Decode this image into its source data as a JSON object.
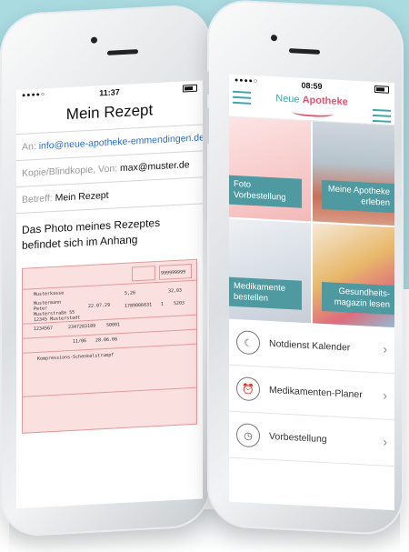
{
  "left_phone": {
    "status_time": "11:37",
    "signal": "●●●●○",
    "mail_title": "Mein Rezept",
    "to_label": "An:",
    "to_value": "info@neue-apotheke-emmendingen.de",
    "cc_label": "Kopie/Blindkopie, Von:",
    "cc_value": "max@muster.de",
    "subject_label": "Betreff:",
    "subject_value": "Mein Rezept",
    "body": "Das Photo meines Rezeptes befindet sich im Anhang",
    "rx": {
      "insurer": "Musterkasse",
      "name_1": "Mustermann",
      "name_2": "Peter",
      "street": "Musterstraße 55",
      "city": "12345 Musterstadt",
      "birth": "22.07.29",
      "id_no": "1234567",
      "number_a": "2347283189",
      "number_b": "50001",
      "date_a": "11/06",
      "date_b": "28.06.06",
      "fee_1": "5,26",
      "fee_2": "32,03",
      "code_1": "999999999",
      "code_2": "1789006631",
      "qty": "1",
      "code_3": "5203",
      "drug": "Kompressions-Schenkelstrumpf"
    }
  },
  "right_phone": {
    "status_time": "08:59",
    "signal": "●●●●○",
    "brand_prefix": "Neue",
    "brand_name": "Apotheke",
    "tiles": [
      {
        "label": "Foto\nVorbestellung"
      },
      {
        "label": "Meine Apotheke\nerleben"
      },
      {
        "label": "Medikamente\nbestellen"
      },
      {
        "label": "Gesundheits-\nmagazin lesen"
      }
    ],
    "list": [
      {
        "label": "Notdienst Kalender",
        "icon": "moon-icon"
      },
      {
        "label": "Medikamenten-Planer",
        "icon": "alarm-clock-icon"
      },
      {
        "label": "Vorbestellung",
        "icon": "clock-icon"
      }
    ]
  }
}
